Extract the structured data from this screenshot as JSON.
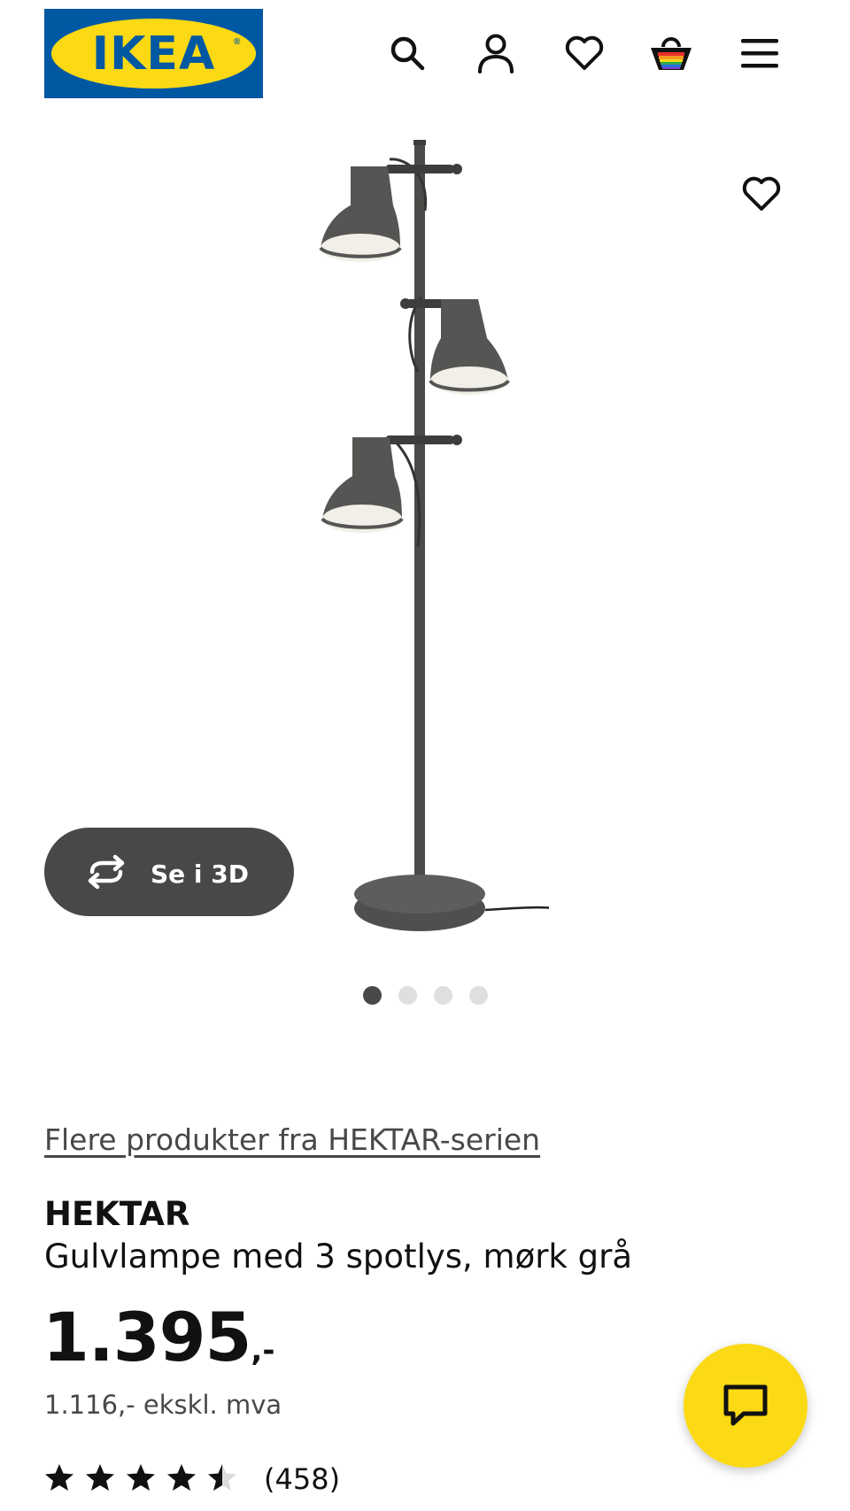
{
  "header": {
    "logo_text": "IKEA",
    "logo_registered": "®",
    "icons": [
      "search-icon",
      "account-icon",
      "heart-icon",
      "cart-icon",
      "menu-icon"
    ]
  },
  "gallery": {
    "view_3d_label": "Se i 3D",
    "image_count": 4,
    "active_image": 1
  },
  "product": {
    "series_link": "Flere produkter fra HEKTAR-serien",
    "name": "HEKTAR",
    "description": "Gulvlampe med 3 spotlys, mørk grå",
    "price_main": "1.395",
    "price_suffix": ",-",
    "price_ex_vat": "1.116,- ekskl. mva",
    "rating_value": 4.5,
    "rating_max": 5,
    "review_count": "(458)"
  },
  "colors": {
    "brand_blue": "#0058a3",
    "brand_yellow": "#fbd914",
    "dark_grey": "#484848"
  }
}
